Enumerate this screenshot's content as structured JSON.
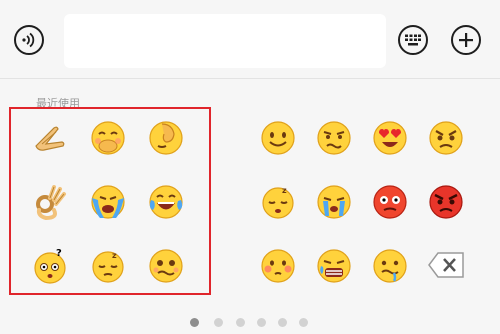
{
  "input_bar": {
    "voice_icon": "voice-icon",
    "keyboard_icon": "keyboard-icon",
    "add_icon": "plus-icon",
    "input_value": ""
  },
  "emoji_panel": {
    "section_label": "最近使用",
    "highlight_color": "#e0252b",
    "recent": [
      {
        "name": "pointing-hand-emoji"
      },
      {
        "name": "giggle-covering-mouth-emoji"
      },
      {
        "name": "facepalm-emoji"
      },
      {
        "name": "ok-hand-emoji"
      },
      {
        "name": "sobbing-emoji"
      },
      {
        "name": "tears-of-joy-emoji"
      },
      {
        "name": "confused-question-emoji"
      },
      {
        "name": "sleepy-emoji"
      },
      {
        "name": "wobbly-face-emoji"
      }
    ],
    "grid": [
      {
        "name": "smile-emoji"
      },
      {
        "name": "grimace-emoji"
      },
      {
        "name": "heart-eyes-emoji"
      },
      {
        "name": "angry-eyebrows-emoji"
      },
      {
        "name": "sleepy-zz-emoji"
      },
      {
        "name": "crying-emoji"
      },
      {
        "name": "flushed-red-emoji"
      },
      {
        "name": "angry-red-emoji"
      },
      {
        "name": "blushing-emoji"
      },
      {
        "name": "laugh-crying-emoji"
      },
      {
        "name": "drooling-emoji"
      }
    ],
    "backspace_icon": "backspace-icon"
  },
  "pagination": {
    "total": 6,
    "active": 1
  }
}
